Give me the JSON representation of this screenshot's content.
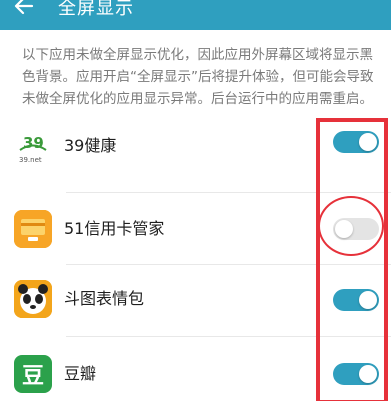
{
  "header": {
    "back_icon": "arrow-left-icon",
    "title": "全屏显示",
    "bg_color": "#2f9fbf"
  },
  "description": "以下应用未做全屏显示优化，因此应用外屏幕区域将显示黑色背景。应用开启“全屏显示”后将提升体验，但可能会导致未做全屏优化的应用显示异常。后台运行中的应用需重启。",
  "apps": [
    {
      "name": "39健康",
      "icon": "39health-icon",
      "icon_text": "39",
      "icon_subtext": "39.net",
      "enabled": true
    },
    {
      "name": "51信用卡管家",
      "icon": "51credit-card-icon",
      "enabled": false
    },
    {
      "name": "斗图表情包",
      "icon": "panda-face-icon",
      "enabled": true
    },
    {
      "name": "豆瓣",
      "icon": "douban-icon",
      "icon_text": "豆",
      "enabled": true
    }
  ],
  "colors": {
    "accent": "#2f9fbf",
    "toggle_off": "#e4e4e4",
    "annotation_red": "#e6313a"
  }
}
